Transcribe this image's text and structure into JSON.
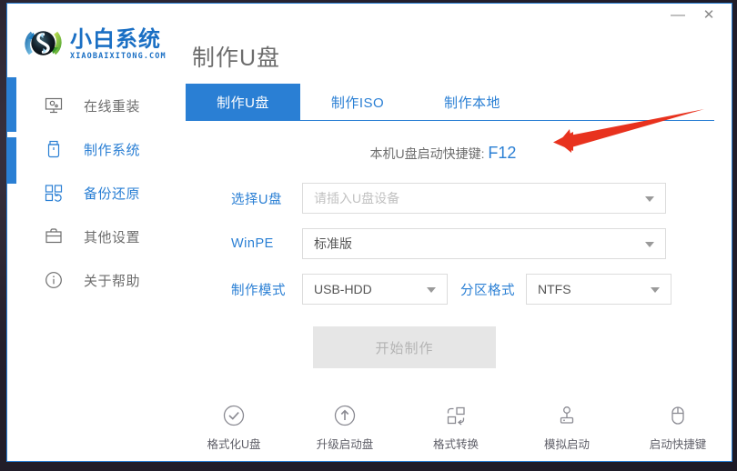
{
  "window": {
    "controls": [
      {
        "name": "minimize",
        "glyph": "—"
      },
      {
        "name": "close",
        "glyph": "✕"
      }
    ]
  },
  "brand": {
    "logo_icon": "recycle-circle-logo",
    "title": "小白系统",
    "subtitle": "XIAOBAIXITONG.COM"
  },
  "header": {
    "page_title": "制作U盘"
  },
  "sidebar": {
    "items": [
      {
        "label": "在线重装",
        "icon": "monitor-icon",
        "accent": false
      },
      {
        "label": "制作系统",
        "icon": "usb-stick-icon",
        "accent": true
      },
      {
        "label": "备份还原",
        "icon": "backup-grid-icon",
        "accent": true
      },
      {
        "label": "其他设置",
        "icon": "toolbox-icon",
        "accent": false
      },
      {
        "label": "关于帮助",
        "icon": "info-circle-icon",
        "accent": false
      }
    ]
  },
  "main": {
    "tabs": [
      {
        "label": "制作U盘",
        "active": true
      },
      {
        "label": "制作ISO",
        "active": false
      },
      {
        "label": "制作本地",
        "active": false
      }
    ],
    "hint": {
      "text": "本机U盘启动快捷键:",
      "key": "F12"
    },
    "form": {
      "usb": {
        "label": "选择U盘",
        "value": "",
        "placeholder": "请插入U盘设备"
      },
      "winpe": {
        "label": "WinPE",
        "value": "标准版",
        "placeholder": ""
      },
      "mode": {
        "label": "制作模式",
        "value": "USB-HDD",
        "placeholder": ""
      },
      "partition": {
        "label": "分区格式",
        "value": "NTFS",
        "placeholder": ""
      }
    },
    "start_button": {
      "label": "开始制作",
      "enabled": false
    }
  },
  "bottom_toolbar": {
    "items": [
      {
        "label": "格式化U盘",
        "icon": "check-circle-icon"
      },
      {
        "label": "升级启动盘",
        "icon": "up-arrow-circle-icon"
      },
      {
        "label": "格式转换",
        "icon": "format-convert-icon"
      },
      {
        "label": "模拟启动",
        "icon": "joystick-icon"
      },
      {
        "label": "启动快捷键",
        "icon": "mouse-icon"
      }
    ]
  },
  "annotation": {
    "type": "red-arrow",
    "color": "#e8321e"
  },
  "colors": {
    "accent": "#2a7fd4",
    "text_muted": "#6d6d6d",
    "disabled_bg": "#e6e6e6",
    "annotation_red": "#e8321e"
  }
}
